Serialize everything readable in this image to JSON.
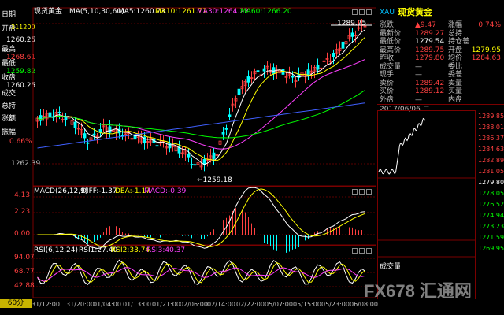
{
  "main": {
    "title": "现货黄金",
    "ma_label": "MA(5,10,30,60)",
    "ma5": "MA5:1260.73",
    "ma10": "MA10:1261.71",
    "ma30": "MA30:1264.22",
    "ma60": "MA60:1266.20",
    "price_ticks": [
      "1289.75",
      "1262.39"
    ],
    "high_label": "1289.75",
    "low_label": "←1259.18"
  },
  "left_panel": {
    "labels": [
      "日期",
      "开盘",
      "最高",
      "最低",
      "收盘",
      "成交",
      "总持",
      "涨额",
      "振幅"
    ],
    "values": {
      "date": "",
      "open": "311200",
      "open2": "1260.25",
      "high": "1268.61",
      "low": "1259.82",
      "close": "1260.25",
      "amp": "0.66%"
    }
  },
  "macd": {
    "label": "MACD(26,12,9)",
    "diff": "DIFF:-1.37",
    "dea": "DEA:-1.17",
    "macd": "MACD:-0.39",
    "ticks": [
      "4.13",
      "2.23",
      "0.00",
      "-2.40"
    ]
  },
  "rsi": {
    "label": "RSI(6,12,24)",
    "rsi1": "RSI1:27.40",
    "rsi2": "RSI2:33.74",
    "rsi3": "RSI3:40.37",
    "ticks": [
      "94.07",
      "68.77",
      "42.88"
    ]
  },
  "bottom": {
    "period": "60分",
    "dates": [
      "31/12:00",
      "31/20:00",
      "01/04:00",
      "01/13:00",
      "01/21:00",
      "02/06:00",
      "02/14:00",
      "02/22:00",
      "05/07:00",
      "05/15:00",
      "05/23:00",
      "06/08:00"
    ]
  },
  "quote": {
    "symbol": "XAU",
    "name": "现货黄金",
    "rows": [
      {
        "l": "涨跌",
        "v": "▲9.47",
        "l2": "涨幅",
        "v2": "0.74%"
      },
      {
        "l": "最新价",
        "v": "1289.27",
        "l2": "总持",
        "v2": ""
      },
      {
        "l": "最低价",
        "v": "1279.54",
        "l2": "持仓差",
        "v2": ""
      },
      {
        "l": "最高价",
        "v": "1289.75",
        "l2": "开盘",
        "v2": "1279.95"
      },
      {
        "l": "昨收",
        "v": "1279.80",
        "l2": "均价",
        "v2": "1284.63"
      },
      {
        "l": "成交量",
        "v": "—",
        "l2": "委比",
        "v2": ""
      },
      {
        "l": "现手",
        "v": "—",
        "l2": "委差",
        "v2": ""
      },
      {
        "l": "卖价",
        "v": "1289.42",
        "l2": "卖量",
        "v2": ""
      },
      {
        "l": "买价",
        "v": "1289.12",
        "l2": "买量",
        "v2": ""
      },
      {
        "l": "外盘",
        "v": "—",
        "l2": "内盘",
        "v2": ""
      }
    ],
    "intraday_date": "2017/06/06 二",
    "intraday_ticks": [
      "1289.85",
      "1288.01",
      "1286.37",
      "1284.63",
      "1282.89",
      "1281.05",
      "1279.80",
      "1278.05",
      "1276.52",
      "1274.94",
      "1273.23",
      "1271.59",
      "1269.95"
    ],
    "volume_label": "成交量"
  },
  "watermark": "FX678 汇通网",
  "colors": {
    "up": "#ff4040",
    "down": "#00ffff",
    "ma5": "#ffffff",
    "ma10": "#ffff00",
    "ma30": "#ff40ff",
    "ma60": "#00ff00",
    "ma_extra": "#4060ff",
    "frame": "#7a0000"
  }
}
